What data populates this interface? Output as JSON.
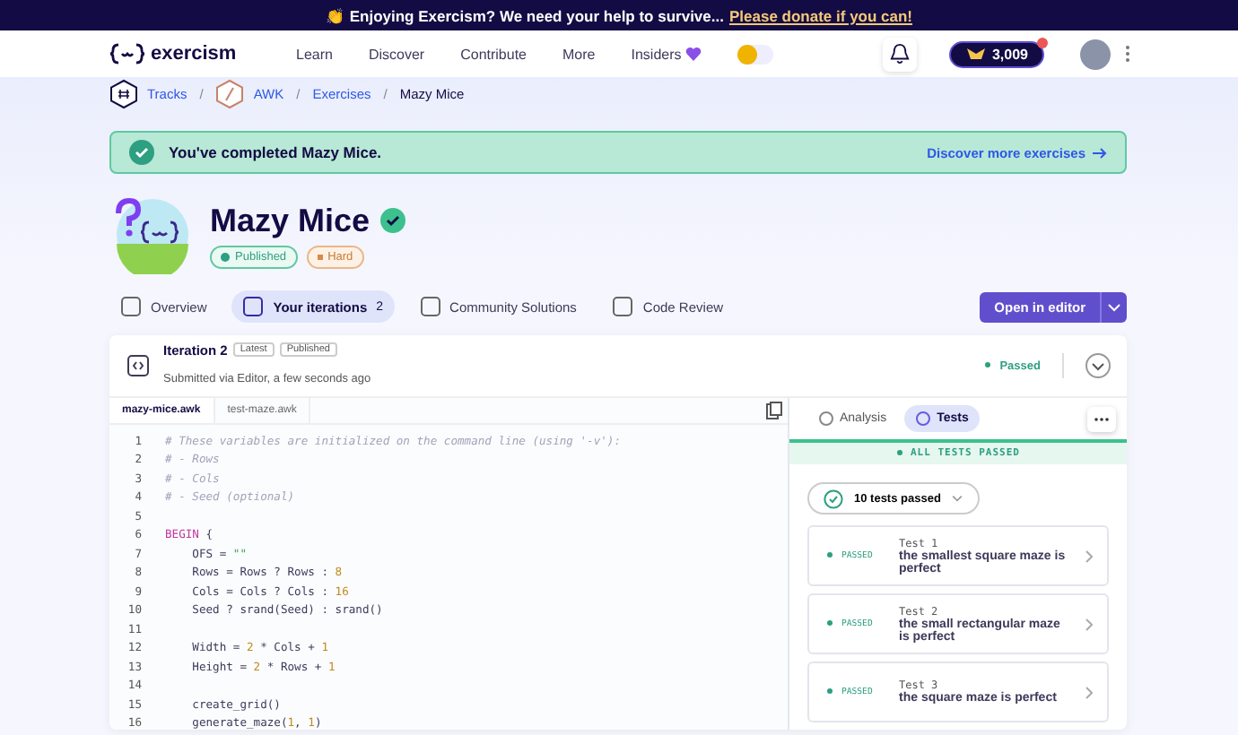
{
  "banner": {
    "emoji": "👏",
    "text": "Enjoying Exercism? We need your help to survive...",
    "link": "Please donate if you can!"
  },
  "nav": {
    "logo": "exercism",
    "items": [
      {
        "label": "Learn"
      },
      {
        "label": "Discover"
      },
      {
        "label": "Contribute"
      },
      {
        "label": "More"
      },
      {
        "label": "Insiders"
      }
    ],
    "theme_on": false,
    "reputation": "3,009",
    "has_unread": true
  },
  "breadcrumb": {
    "separator": "/",
    "items": [
      {
        "label": "Tracks",
        "link": true
      },
      {
        "label": "AWK",
        "link": true
      },
      {
        "label": "Exercises",
        "link": true
      },
      {
        "label": "Mazy Mice",
        "link": false
      }
    ]
  },
  "completion": {
    "message": "You've completed Mazy Mice.",
    "link": "Discover more exercises"
  },
  "exercise": {
    "title": "Mazy Mice",
    "completed": true,
    "tags": [
      {
        "kind": "published",
        "label": "Published"
      },
      {
        "kind": "difficulty",
        "label": "Hard"
      }
    ]
  },
  "tabs": [
    {
      "label": "Overview",
      "selected": false
    },
    {
      "label": "Your iterations",
      "count": "2",
      "selected": true
    },
    {
      "label": "Community Solutions",
      "selected": false
    },
    {
      "label": "Code Review",
      "selected": false
    }
  ],
  "open_button": "Open in editor",
  "iteration": {
    "title": "Iteration 2",
    "badges": [
      "Latest",
      "Published"
    ],
    "submitted": "Submitted via Editor, a few seconds ago",
    "status": "Passed"
  },
  "files": [
    {
      "name": "mazy-mice.awk",
      "selected": true
    },
    {
      "name": "test-maze.awk",
      "selected": false
    }
  ],
  "code": [
    {
      "n": "1",
      "tokens": [
        {
          "kind": "comment",
          "text": "# These variables are initialized on the command line (using '-v'):"
        }
      ]
    },
    {
      "n": "2",
      "tokens": [
        {
          "kind": "comment",
          "text": "# - Rows"
        }
      ]
    },
    {
      "n": "3",
      "tokens": [
        {
          "kind": "comment",
          "text": "# - Cols"
        }
      ]
    },
    {
      "n": "4",
      "tokens": [
        {
          "kind": "comment",
          "text": "# - Seed (optional)"
        }
      ]
    },
    {
      "n": "5"
    },
    {
      "n": "6",
      "tokens": [
        {
          "kind": "keyword",
          "text": "BEGIN"
        },
        {
          "kind": "plain",
          "text": " {"
        }
      ]
    },
    {
      "n": "7",
      "tokens": [
        {
          "kind": "plain",
          "text": "    OFS = "
        },
        {
          "kind": "string",
          "text": "\"\""
        }
      ]
    },
    {
      "n": "8",
      "tokens": [
        {
          "kind": "plain",
          "text": "    Rows = Rows ? Rows : "
        },
        {
          "kind": "number",
          "text": "8"
        }
      ]
    },
    {
      "n": "9",
      "tokens": [
        {
          "kind": "plain",
          "text": "    Cols = Cols ? Cols : "
        },
        {
          "kind": "number",
          "text": "16"
        }
      ]
    },
    {
      "n": "10",
      "tokens": [
        {
          "kind": "plain",
          "text": "    Seed ? srand(Seed) : srand()"
        }
      ]
    },
    {
      "n": "11"
    },
    {
      "n": "12",
      "tokens": [
        {
          "kind": "plain",
          "text": "    Width = "
        },
        {
          "kind": "number",
          "text": "2"
        },
        {
          "kind": "plain",
          "text": " * Cols + "
        },
        {
          "kind": "number",
          "text": "1"
        }
      ]
    },
    {
      "n": "13",
      "tokens": [
        {
          "kind": "plain",
          "text": "    Height = "
        },
        {
          "kind": "number",
          "text": "2"
        },
        {
          "kind": "plain",
          "text": " * Rows + "
        },
        {
          "kind": "number",
          "text": "1"
        }
      ]
    },
    {
      "n": "14"
    },
    {
      "n": "15",
      "tokens": [
        {
          "kind": "plain",
          "text": "    create_grid()"
        }
      ]
    },
    {
      "n": "16",
      "tokens": [
        {
          "kind": "plain",
          "text": "    generate_maze("
        },
        {
          "kind": "number",
          "text": "1"
        },
        {
          "kind": "plain",
          "text": ", "
        },
        {
          "kind": "number",
          "text": "1"
        },
        {
          "kind": "plain",
          "text": ")"
        }
      ]
    }
  ],
  "results": {
    "tabs": [
      {
        "label": "Analysis",
        "selected": false
      },
      {
        "label": "Tests",
        "selected": true
      }
    ],
    "summary": "ALL TESTS PASSED",
    "count": "10 tests passed",
    "tests": [
      {
        "status": "PASSED",
        "name": "Test 1",
        "description": "the smallest square maze is perfect"
      },
      {
        "status": "PASSED",
        "name": "Test 2",
        "description": "the small rectangular maze is perfect"
      },
      {
        "status": "PASSED",
        "name": "Test 3",
        "description": "the square maze is perfect"
      }
    ]
  }
}
